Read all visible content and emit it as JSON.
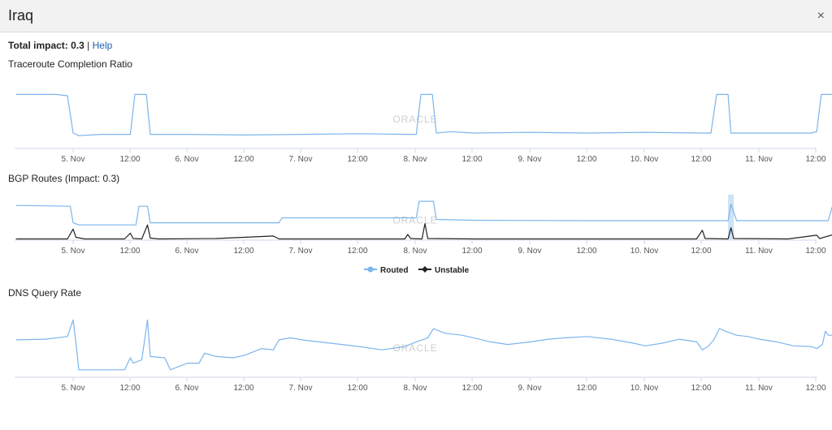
{
  "window": {
    "title": "Iraq",
    "close_symbol": "×"
  },
  "impact": {
    "label": "Total impact: 0.3",
    "separator": "|",
    "help": "Help"
  },
  "watermark": "ORACLE",
  "colors": {
    "routed": "#7cb5ec",
    "unstable": "#222222",
    "highlight": "#b8d6f3"
  },
  "chart_data": [
    {
      "type": "line",
      "title": "Traceroute Completion Ratio",
      "x_ticks": [
        "5. Nov",
        "12:00",
        "6. Nov",
        "12:00",
        "7. Nov",
        "12:00",
        "8. Nov",
        "12:00",
        "9. Nov",
        "12:00",
        "10. Nov",
        "12:00",
        "11. Nov",
        "12:00"
      ],
      "x_range": [
        "4. Nov 14:00",
        "11. Nov 12:30"
      ],
      "series": [
        {
          "color": "#7cb5ec",
          "points": [
            [
              0,
              0.8
            ],
            [
              0.25,
              0.8
            ],
            [
              0.7,
              0.8
            ],
            [
              0.9,
              0.78
            ],
            [
              1.0,
              0.22
            ],
            [
              1.1,
              0.18
            ],
            [
              1.5,
              0.2
            ],
            [
              1.8,
              0.2
            ],
            [
              2.0,
              0.2
            ],
            [
              2.08,
              0.8
            ],
            [
              2.28,
              0.8
            ],
            [
              2.35,
              0.2
            ],
            [
              3.0,
              0.2
            ],
            [
              4.0,
              0.19
            ],
            [
              5.0,
              0.2
            ],
            [
              6.0,
              0.21
            ],
            [
              6.9,
              0.2
            ],
            [
              7.0,
              0.2
            ],
            [
              7.08,
              0.8
            ],
            [
              7.28,
              0.8
            ],
            [
              7.35,
              0.22
            ],
            [
              7.6,
              0.24
            ],
            [
              8.0,
              0.22
            ],
            [
              9.0,
              0.23
            ],
            [
              10.0,
              0.22
            ],
            [
              11.0,
              0.23
            ],
            [
              12.0,
              0.22
            ],
            [
              12.15,
              0.22
            ],
            [
              12.25,
              0.8
            ],
            [
              12.45,
              0.8
            ],
            [
              12.5,
              0.22
            ],
            [
              13.0,
              0.22
            ],
            [
              13.9,
              0.22
            ],
            [
              14.0,
              0.24
            ],
            [
              14.08,
              0.8
            ],
            [
              14.5,
              0.8
            ],
            [
              14.55,
              0.24
            ],
            [
              15.5,
              0.24
            ],
            [
              15.7,
              0.24
            ],
            [
              15.75,
              0.8
            ],
            [
              16.1,
              0.78
            ]
          ]
        }
      ]
    },
    {
      "type": "line",
      "title": "BGP Routes (Impact: 0.3)",
      "x_ticks": [
        "5. Nov",
        "12:00",
        "6. Nov",
        "12:00",
        "7. Nov",
        "12:00",
        "8. Nov",
        "12:00",
        "9. Nov",
        "12:00",
        "10. Nov",
        "12:00",
        "11. Nov",
        "12:00"
      ],
      "x_range": [
        "4. Nov 14:00",
        "11. Nov 12:30"
      ],
      "highlight_x": [
        12.45,
        12.55
      ],
      "series": [
        {
          "name": "Routed",
          "color": "#7cb5ec",
          "points": [
            [
              0,
              0.82
            ],
            [
              0.95,
              0.8
            ],
            [
              1.0,
              0.4
            ],
            [
              1.1,
              0.35
            ],
            [
              1.5,
              0.35
            ],
            [
              2.1,
              0.35
            ],
            [
              2.15,
              0.8
            ],
            [
              2.3,
              0.8
            ],
            [
              2.35,
              0.4
            ],
            [
              4.0,
              0.4
            ],
            [
              4.6,
              0.4
            ],
            [
              4.65,
              0.52
            ],
            [
              6.9,
              0.52
            ],
            [
              7.0,
              0.52
            ],
            [
              7.05,
              0.92
            ],
            [
              7.3,
              0.92
            ],
            [
              7.35,
              0.48
            ],
            [
              8.0,
              0.46
            ],
            [
              10.0,
              0.45
            ],
            [
              12.0,
              0.45
            ],
            [
              12.45,
              0.45
            ],
            [
              12.5,
              0.85
            ],
            [
              12.6,
              0.45
            ],
            [
              14.2,
              0.45
            ],
            [
              14.3,
              0.92
            ],
            [
              14.8,
              0.92
            ],
            [
              14.9,
              0.45
            ],
            [
              16.4,
              0.45
            ],
            [
              16.5,
              0.9
            ],
            [
              16.8,
              0.9
            ]
          ]
        },
        {
          "name": "Unstable",
          "color": "#222222",
          "points": [
            [
              0,
              0.01
            ],
            [
              0.9,
              0.01
            ],
            [
              1.0,
              0.25
            ],
            [
              1.05,
              0.05
            ],
            [
              1.2,
              0.01
            ],
            [
              1.9,
              0.01
            ],
            [
              2.0,
              0.15
            ],
            [
              2.05,
              0.02
            ],
            [
              2.2,
              0.01
            ],
            [
              2.3,
              0.35
            ],
            [
              2.35,
              0.03
            ],
            [
              2.5,
              0.01
            ],
            [
              3.5,
              0.02
            ],
            [
              4.5,
              0.08
            ],
            [
              4.6,
              0.01
            ],
            [
              5.5,
              0.01
            ],
            [
              6.8,
              0.01
            ],
            [
              6.85,
              0.12
            ],
            [
              6.9,
              0.02
            ],
            [
              7.1,
              0.01
            ],
            [
              7.15,
              0.38
            ],
            [
              7.2,
              0.02
            ],
            [
              8.0,
              0.01
            ],
            [
              10.0,
              0.01
            ],
            [
              11.9,
              0.01
            ],
            [
              12.0,
              0.22
            ],
            [
              12.05,
              0.02
            ],
            [
              12.45,
              0.01
            ],
            [
              12.5,
              0.28
            ],
            [
              12.55,
              0.02
            ],
            [
              13.5,
              0.01
            ],
            [
              14.0,
              0.1
            ],
            [
              14.05,
              0.02
            ],
            [
              14.3,
              0.12
            ],
            [
              14.35,
              0.02
            ],
            [
              14.7,
              0.01
            ],
            [
              14.8,
              0.38
            ],
            [
              14.85,
              0.02
            ],
            [
              15.9,
              0.01
            ],
            [
              16.0,
              0.22
            ],
            [
              16.05,
              0.02
            ],
            [
              16.8,
              0.01
            ]
          ]
        }
      ]
    },
    {
      "type": "line",
      "title": "DNS Query Rate",
      "x_ticks": [
        "5. Nov",
        "12:00",
        "6. Nov",
        "12:00",
        "7. Nov",
        "12:00",
        "8. Nov",
        "12:00",
        "9. Nov",
        "12:00",
        "10. Nov",
        "12:00",
        "11. Nov",
        "12:00"
      ],
      "x_range": [
        "4. Nov 14:00",
        "11. Nov 12:30"
      ],
      "series": [
        {
          "color": "#7cb5ec",
          "points": [
            [
              0,
              0.55
            ],
            [
              0.5,
              0.56
            ],
            [
              0.9,
              0.6
            ],
            [
              1.0,
              0.85
            ],
            [
              1.05,
              0.5
            ],
            [
              1.1,
              0.1
            ],
            [
              1.5,
              0.1
            ],
            [
              1.9,
              0.1
            ],
            [
              2.0,
              0.28
            ],
            [
              2.05,
              0.2
            ],
            [
              2.2,
              0.25
            ],
            [
              2.3,
              0.85
            ],
            [
              2.35,
              0.3
            ],
            [
              2.6,
              0.28
            ],
            [
              2.7,
              0.1
            ],
            [
              3.0,
              0.2
            ],
            [
              3.2,
              0.2
            ],
            [
              3.3,
              0.35
            ],
            [
              3.5,
              0.3
            ],
            [
              3.8,
              0.28
            ],
            [
              4.0,
              0.32
            ],
            [
              4.3,
              0.42
            ],
            [
              4.5,
              0.4
            ],
            [
              4.6,
              0.55
            ],
            [
              4.8,
              0.58
            ],
            [
              5.0,
              0.55
            ],
            [
              5.3,
              0.52
            ],
            [
              5.5,
              0.5
            ],
            [
              6.0,
              0.45
            ],
            [
              6.4,
              0.4
            ],
            [
              6.8,
              0.45
            ],
            [
              7.0,
              0.52
            ],
            [
              7.2,
              0.58
            ],
            [
              7.3,
              0.72
            ],
            [
              7.5,
              0.65
            ],
            [
              7.8,
              0.62
            ],
            [
              8.0,
              0.58
            ],
            [
              8.3,
              0.52
            ],
            [
              8.6,
              0.48
            ],
            [
              8.8,
              0.5
            ],
            [
              9.0,
              0.52
            ],
            [
              9.3,
              0.56
            ],
            [
              9.6,
              0.58
            ],
            [
              10.0,
              0.6
            ],
            [
              10.4,
              0.56
            ],
            [
              10.8,
              0.5
            ],
            [
              11.0,
              0.46
            ],
            [
              11.3,
              0.5
            ],
            [
              11.6,
              0.56
            ],
            [
              11.9,
              0.52
            ],
            [
              12.0,
              0.4
            ],
            [
              12.1,
              0.45
            ],
            [
              12.2,
              0.55
            ],
            [
              12.3,
              0.72
            ],
            [
              12.4,
              0.68
            ],
            [
              12.6,
              0.62
            ],
            [
              12.8,
              0.6
            ],
            [
              13.0,
              0.56
            ],
            [
              13.3,
              0.52
            ],
            [
              13.6,
              0.46
            ],
            [
              13.9,
              0.45
            ],
            [
              14.0,
              0.42
            ],
            [
              14.1,
              0.48
            ],
            [
              14.15,
              0.68
            ],
            [
              14.2,
              0.62
            ],
            [
              14.5,
              0.62
            ],
            [
              14.8,
              0.58
            ],
            [
              15.1,
              0.5
            ],
            [
              15.4,
              0.44
            ],
            [
              15.6,
              0.42
            ],
            [
              15.9,
              0.44
            ],
            [
              16.2,
              0.42
            ],
            [
              16.4,
              0.4
            ],
            [
              16.6,
              0.42
            ]
          ]
        }
      ]
    }
  ]
}
